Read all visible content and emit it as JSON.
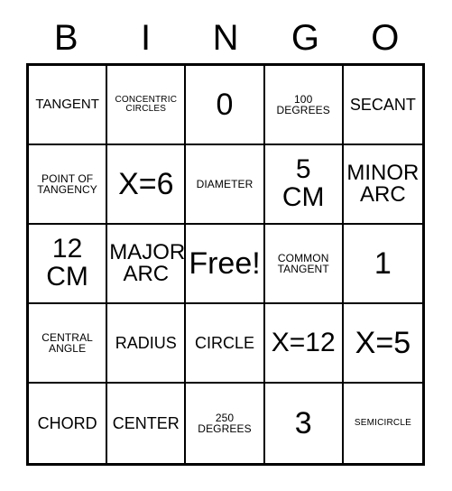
{
  "card": {
    "title": "BINGO",
    "free_space_label": "Free!",
    "background_color": "#ffffff",
    "border_color": "#000000",
    "text_color": "#000000"
  },
  "headers": [
    {
      "letter": "B"
    },
    {
      "letter": "I"
    },
    {
      "letter": "N"
    },
    {
      "letter": "G"
    },
    {
      "letter": "O"
    }
  ],
  "rows": [
    [
      {
        "text": "TANGENT",
        "size": "md"
      },
      {
        "text": "CONCENTRIC\nCIRCLES",
        "size": "xs"
      },
      {
        "text": "0",
        "size": "huge"
      },
      {
        "text": "100\nDEGREES",
        "size": "sm"
      },
      {
        "text": "SECANT",
        "size": "lg"
      }
    ],
    [
      {
        "text": "POINT OF\nTANGENCY",
        "size": "sm"
      },
      {
        "text": "X=6",
        "size": "huge"
      },
      {
        "text": "DIAMETER",
        "size": "sm"
      },
      {
        "text": "5\nCM",
        "size": "xxl"
      },
      {
        "text": "MINOR\nARC",
        "size": "xl"
      }
    ],
    [
      {
        "text": "12\nCM",
        "size": "xxl"
      },
      {
        "text": "MAJOR\nARC",
        "size": "xl"
      },
      {
        "text": "Free!",
        "size": "huge"
      },
      {
        "text": "COMMON\nTANGENT",
        "size": "sm"
      },
      {
        "text": "1",
        "size": "huge"
      }
    ],
    [
      {
        "text": "CENTRAL\nANGLE",
        "size": "sm"
      },
      {
        "text": "RADIUS",
        "size": "lg"
      },
      {
        "text": "CIRCLE",
        "size": "lg"
      },
      {
        "text": "X=12",
        "size": "xxl"
      },
      {
        "text": "X=5",
        "size": "huge"
      }
    ],
    [
      {
        "text": "CHORD",
        "size": "lg"
      },
      {
        "text": "CENTER",
        "size": "lg"
      },
      {
        "text": "250\nDEGREES",
        "size": "sm"
      },
      {
        "text": "3",
        "size": "huge"
      },
      {
        "text": "SEMICIRCLE",
        "size": "xs"
      }
    ]
  ]
}
